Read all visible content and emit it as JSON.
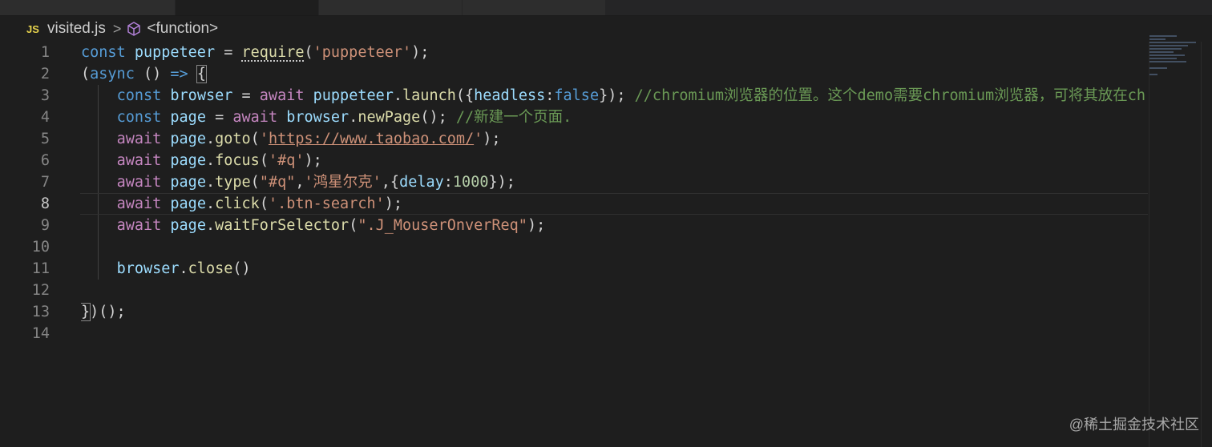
{
  "breadcrumb": {
    "language_badge": "JS",
    "file": "visited.js",
    "separator": ">",
    "symbol_icon": "cube-icon",
    "symbol": "<function>"
  },
  "editor": {
    "active_line": 8,
    "lines": [
      {
        "number": "1",
        "tokens": [
          [
            "kw",
            "const"
          ],
          [
            "",
            " "
          ],
          [
            "var",
            "puppeteer"
          ],
          [
            "",
            " = "
          ],
          [
            "fn",
            "require"
          ],
          [
            "",
            "("
          ],
          [
            "str",
            "'puppeteer'"
          ],
          [
            "",
            ");"
          ]
        ]
      },
      {
        "number": "2",
        "tokens": [
          [
            "",
            "("
          ],
          [
            "kw",
            "async"
          ],
          [
            "",
            " () "
          ],
          [
            "kw",
            "=>"
          ],
          [
            "",
            " {"
          ]
        ]
      },
      {
        "number": "3",
        "tokens": [
          [
            "",
            "    "
          ],
          [
            "kw",
            "const"
          ],
          [
            "",
            " "
          ],
          [
            "var",
            "browser"
          ],
          [
            "",
            " = "
          ],
          [
            "ctl",
            "await"
          ],
          [
            "",
            " "
          ],
          [
            "var",
            "puppeteer"
          ],
          [
            "",
            "."
          ],
          [
            "fn",
            "launch"
          ],
          [
            "",
            "({"
          ],
          [
            "var",
            "headless"
          ],
          [
            "",
            ":"
          ],
          [
            "kw",
            "false"
          ],
          [
            "",
            "}); "
          ],
          [
            "cmt",
            "//chromium浏览器的位置。这个demo需要chromium浏览器，可将其放在chrome同级目录下"
          ]
        ]
      },
      {
        "number": "4",
        "tokens": [
          [
            "",
            "    "
          ],
          [
            "kw",
            "const"
          ],
          [
            "",
            " "
          ],
          [
            "var",
            "page"
          ],
          [
            "",
            " = "
          ],
          [
            "ctl",
            "await"
          ],
          [
            "",
            " "
          ],
          [
            "var",
            "browser"
          ],
          [
            "",
            "."
          ],
          [
            "fn",
            "newPage"
          ],
          [
            "",
            "(); "
          ],
          [
            "cmt",
            "//新建一个页面."
          ]
        ]
      },
      {
        "number": "5",
        "tokens": [
          [
            "",
            "    "
          ],
          [
            "ctl",
            "await"
          ],
          [
            "",
            " "
          ],
          [
            "var",
            "page"
          ],
          [
            "",
            "."
          ],
          [
            "fn",
            "goto"
          ],
          [
            "",
            "("
          ],
          [
            "str",
            "'"
          ],
          [
            "link",
            "https://www.taobao.com/"
          ],
          [
            "str",
            "'"
          ],
          [
            "",
            ");"
          ]
        ]
      },
      {
        "number": "6",
        "tokens": [
          [
            "",
            "    "
          ],
          [
            "ctl",
            "await"
          ],
          [
            "",
            " "
          ],
          [
            "var",
            "page"
          ],
          [
            "",
            "."
          ],
          [
            "fn",
            "focus"
          ],
          [
            "",
            "("
          ],
          [
            "str",
            "'#q'"
          ],
          [
            "",
            ");"
          ]
        ]
      },
      {
        "number": "7",
        "tokens": [
          [
            "",
            "    "
          ],
          [
            "ctl",
            "await"
          ],
          [
            "",
            " "
          ],
          [
            "var",
            "page"
          ],
          [
            "",
            "."
          ],
          [
            "fn",
            "type"
          ],
          [
            "",
            "("
          ],
          [
            "str",
            "\"#q\""
          ],
          [
            "",
            ","
          ],
          [
            "str",
            "'鸿星尔克'"
          ],
          [
            "",
            ",{"
          ],
          [
            "var",
            "delay"
          ],
          [
            "",
            ":"
          ],
          [
            "num",
            "1000"
          ],
          [
            "",
            "});"
          ]
        ]
      },
      {
        "number": "8",
        "tokens": [
          [
            "",
            "    "
          ],
          [
            "ctl",
            "await"
          ],
          [
            "",
            " "
          ],
          [
            "var",
            "page"
          ],
          [
            "",
            "."
          ],
          [
            "fn",
            "click"
          ],
          [
            "",
            "("
          ],
          [
            "str",
            "'.btn-search'"
          ],
          [
            "",
            ");"
          ]
        ]
      },
      {
        "number": "9",
        "tokens": [
          [
            "",
            "    "
          ],
          [
            "ctl",
            "await"
          ],
          [
            "",
            " "
          ],
          [
            "var",
            "page"
          ],
          [
            "",
            "."
          ],
          [
            "fn",
            "waitForSelector"
          ],
          [
            "",
            "("
          ],
          [
            "str",
            "\".J_MouserOnverReq\""
          ],
          [
            "",
            ");"
          ]
        ]
      },
      {
        "number": "10",
        "tokens": []
      },
      {
        "number": "11",
        "tokens": [
          [
            "",
            "    "
          ],
          [
            "var",
            "browser"
          ],
          [
            "",
            "."
          ],
          [
            "fn",
            "close"
          ],
          [
            "",
            "()"
          ]
        ]
      },
      {
        "number": "12",
        "tokens": []
      },
      {
        "number": "13",
        "tokens": [
          [
            "",
            "})();"
          ]
        ]
      },
      {
        "number": "14",
        "tokens": []
      }
    ]
  },
  "watermark": "@稀土掘金技术社区"
}
